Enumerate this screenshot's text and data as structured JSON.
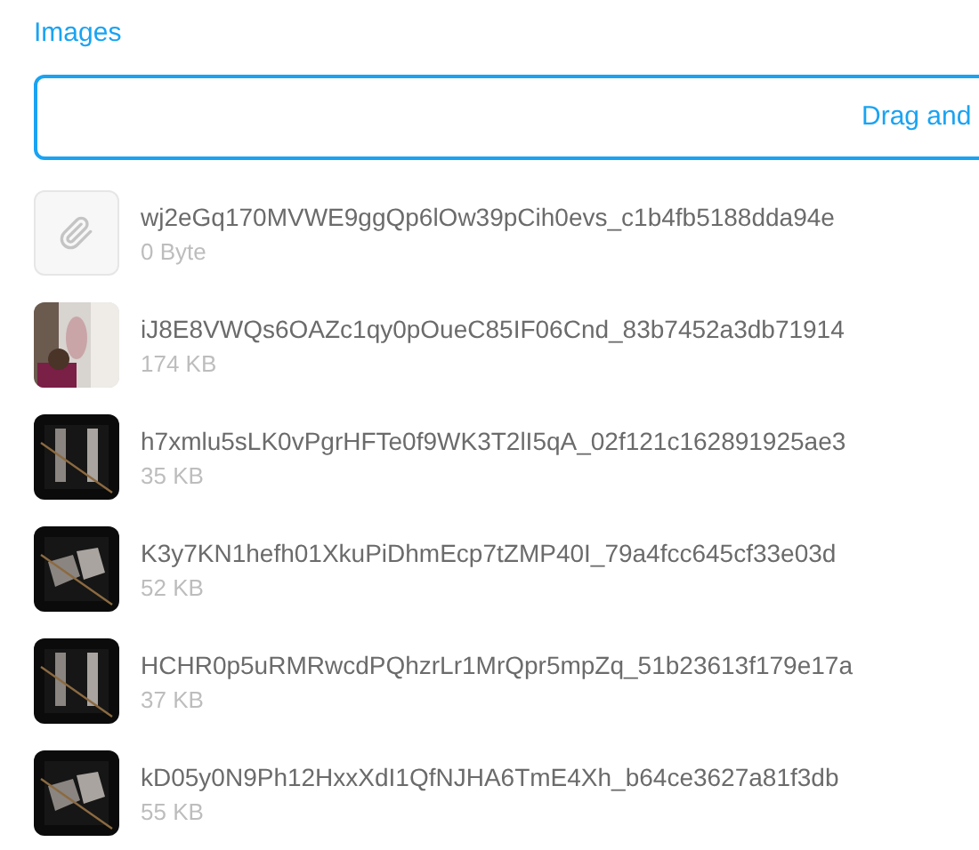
{
  "label": "Images",
  "dropzone": {
    "text": "Drag and"
  },
  "files": [
    {
      "kind": "file",
      "name": "wj2eGq170MVWE9ggQp6lOw39pCih0evs_c1b4fb5188dda94e",
      "size": "0 Byte"
    },
    {
      "kind": "picture",
      "name": "iJ8E8VWQs6OAZc1qy0pOueC85IF06Cnd_83b7452a3db71914",
      "size": "174 KB"
    },
    {
      "kind": "picture",
      "name": "h7xmlu5sLK0vPgrHFTe0f9WK3T2lI5qA_02f121c162891925ae3",
      "size": "35 KB"
    },
    {
      "kind": "picture",
      "name": "K3y7KN1hefh01XkuPiDhmEcp7tZMP40I_79a4fcc645cf33e03d",
      "size": "52 KB"
    },
    {
      "kind": "picture",
      "name": "HCHR0p5uRMRwcdPQhzrLr1MrQpr5mpZq_51b23613f179e17a",
      "size": "37 KB"
    },
    {
      "kind": "picture",
      "name": "kD05y0N9Ph12HxxXdI1QfNJHA6TmE4Xh_b64ce3627a81f3db",
      "size": "55 KB"
    }
  ]
}
